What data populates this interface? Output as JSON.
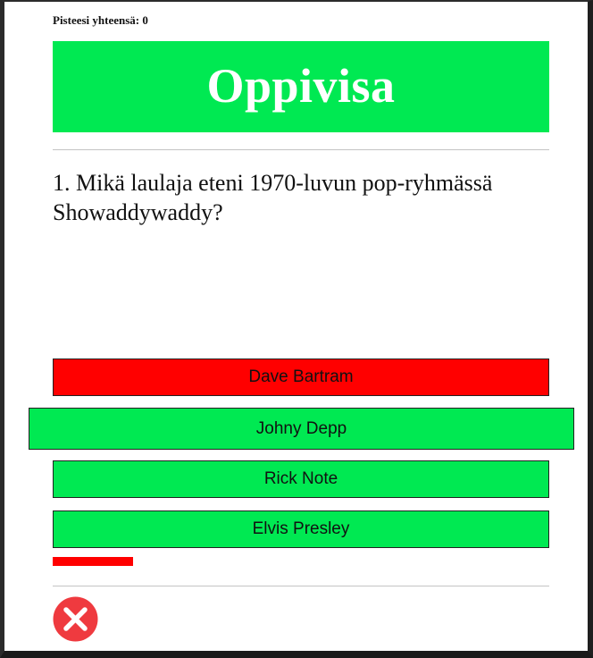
{
  "score": {
    "label": "Pisteesi yhteensä: 0"
  },
  "header": {
    "title": "Oppivisa"
  },
  "question": {
    "text": "1. Mikä laulaja eteni 1970-luvun pop-ryhmässä Showaddywaddy?"
  },
  "answers": [
    {
      "label": "Dave Bartram",
      "color": "#ff0000"
    },
    {
      "label": "Johny Depp",
      "color": "#00e952"
    },
    {
      "label": "Rick Note",
      "color": "#00e952"
    },
    {
      "label": "Elvis Presley",
      "color": "#00e952"
    }
  ],
  "progress": {
    "color": "#ff0000"
  },
  "close": {
    "icon": "close-icon",
    "color": "#ef3a3f"
  },
  "colors": {
    "accent_green": "#00e952",
    "wrong_red": "#ff0000",
    "divider": "#c4c4c4"
  }
}
